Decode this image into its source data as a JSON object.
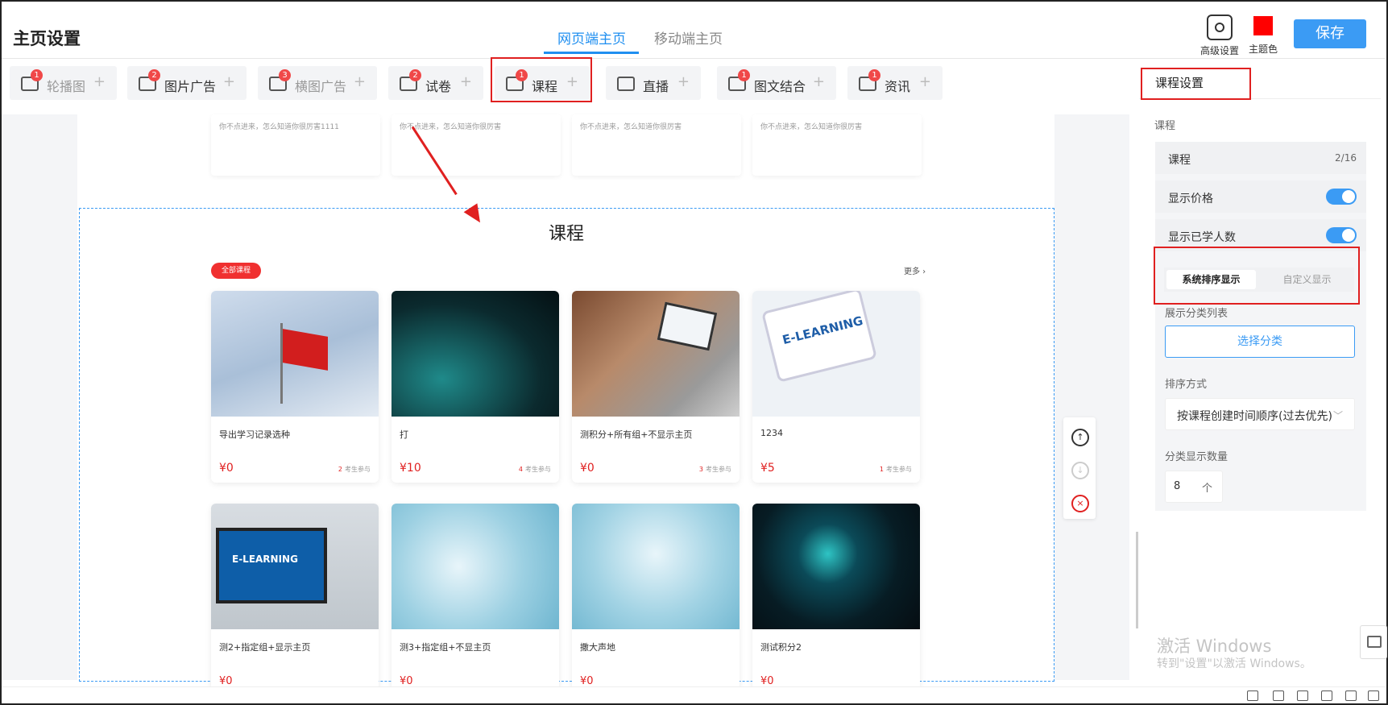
{
  "header": {
    "title": "主页设置",
    "tabs": [
      {
        "label": "网页端主页",
        "active": true
      },
      {
        "label": "移动端主页",
        "active": false
      }
    ],
    "advanced_label": "高级设置",
    "theme_label": "主题色",
    "theme_color": "#ff0000",
    "save_label": "保存"
  },
  "components": [
    {
      "label": "轮播图",
      "count": "1",
      "icon": "carousel-icon"
    },
    {
      "label": "图片广告",
      "count": "2",
      "icon": "image-ad-icon"
    },
    {
      "label": "横图广告",
      "count": "3",
      "icon": "banner-ad-icon"
    },
    {
      "label": "试卷",
      "count": "2",
      "icon": "exam-icon"
    },
    {
      "label": "课程",
      "count": "1",
      "icon": "book-icon"
    },
    {
      "label": "直播",
      "count": "",
      "icon": "tv-icon"
    },
    {
      "label": "图文结合",
      "count": "1",
      "icon": "image-text-icon"
    },
    {
      "label": "资讯",
      "count": "1",
      "icon": "news-icon"
    }
  ],
  "preview": {
    "prev_card_text": "你不点进来，怎么知道你很厉害1111",
    "prev_card_text2": "你不点进来，怎么知道你很厉害",
    "section_title": "课程",
    "pill_label": "全部课程",
    "more_label": "更多",
    "courses": [
      {
        "name": "导出学习记录选种",
        "price": "¥0",
        "count": "2",
        "suffix": "考生参与"
      },
      {
        "name": "打",
        "price": "¥10",
        "count": "4",
        "suffix": "考生参与"
      },
      {
        "name": "测积分+所有组+不显示主页",
        "price": "¥0",
        "count": "3",
        "suffix": "考生参与"
      },
      {
        "name": "1234",
        "price": "¥5",
        "count": "1",
        "suffix": "考生参与"
      },
      {
        "name": "测2+指定组+显示主页",
        "price": "¥0",
        "count": "",
        "suffix": ""
      },
      {
        "name": "测3+指定组+不显主页",
        "price": "¥0",
        "count": "",
        "suffix": ""
      },
      {
        "name": "撒大声地",
        "price": "¥0",
        "count": "",
        "suffix": ""
      },
      {
        "name": "测试积分2",
        "price": "¥0",
        "count": "",
        "suffix": ""
      }
    ]
  },
  "panel": {
    "title": "课程设置",
    "section_label": "课程",
    "course_row_label": "课程",
    "course_row_value": "2/16",
    "show_price_label": "显示价格",
    "show_price": true,
    "show_learners_label": "显示已学人数",
    "show_learners": true,
    "seg_system": "系统排序显示",
    "seg_custom": "自定义显示",
    "category_list_label": "展示分类列表",
    "select_category": "选择分类",
    "sort_label": "排序方式",
    "sort_value": "按课程创建时间顺序(过去优先)",
    "count_label": "分类显示数量",
    "count_value": "8",
    "count_unit": "个"
  },
  "watermark": {
    "line1": "激活 Windows",
    "line2": "转到\"设置\"以激活 Windows。"
  }
}
